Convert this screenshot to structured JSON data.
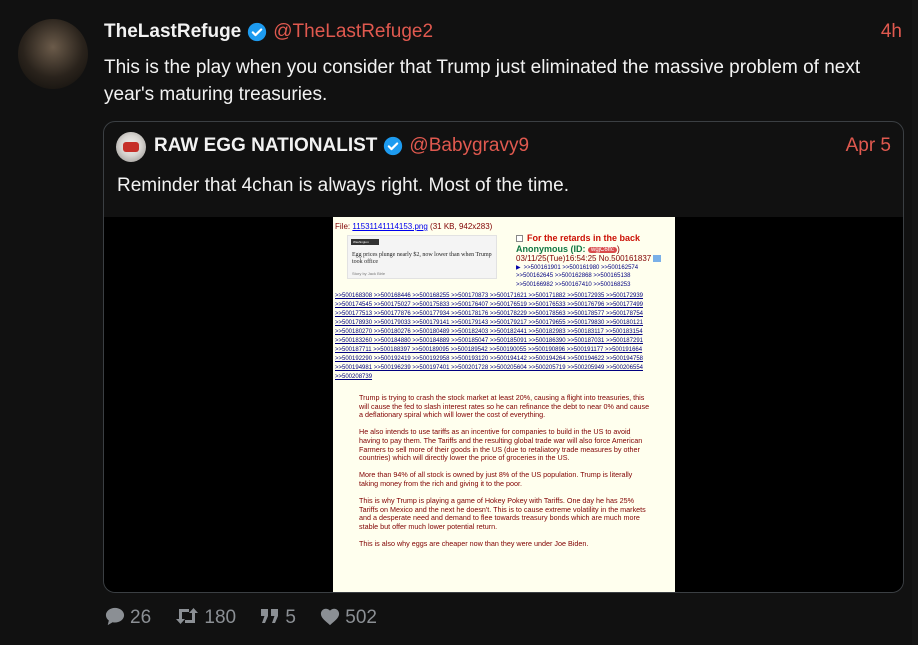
{
  "post": {
    "display_name": "TheLastRefuge",
    "handle": "@TheLastRefuge2",
    "time": "4h",
    "text": "This is the play when you consider that Trump just eliminated the massive problem of next year's maturing treasuries."
  },
  "quoted": {
    "display_name": "RAW EGG NATIONALIST",
    "handle": "@Babygravy9",
    "time": "Apr 5",
    "text": "Reminder that 4chan is always right. Most of the time."
  },
  "chan": {
    "file_prefix": "File: ",
    "file_name": "11531141114153.png",
    "file_meta": " (31 KB, 942x283)",
    "thumb_label": "Washington Examiner",
    "thumb_headline": "Egg prices plunge nearly $2, now lower than when Trump took office",
    "thumb_meta": "Story by Jack Birle",
    "subject": "For the retards in the back",
    "anon": "Anonymous (ID: ",
    "anon_id": "wgjC6ffc",
    "anon_close": ")",
    "datetime": "03/11/25(Tue)16:54:25 No.500161837",
    "replies_line1": ">>500161901 >>500161980 >>500162574",
    "replies_line2": ">>500162645 >>500162868 >>500165138",
    "replies_line3": ">>500166982 >>500167410 >>500168253",
    "replies": ">>500168308 >>500168446 >>500168255 >>500170873 >>500171621 >>500171882 >>500172935 >>500172939 >>500174545 >>500175027 >>500175833 >>500176407 >>500176519 >>500176533 >>500176796 >>500177499 >>500177513 >>500177876 >>500177934 >>500178176 >>500178229 >>500178563 >>500178577 >>500178754 >>500178930 >>500179033 >>500179141 >>500179143 >>500179217 >>500179655 >>500179830 >>500180121 >>500180270 >>500180276 >>500180489 >>500182403 >>500182441 >>500182983 >>500183117 >>500183154 >>500183260 >>500184880 >>500184889 >>500185047 >>500185091 >>500186390 >>500187031 >>500187291 >>500187711 >>500188397 >>500189095 >>500189542 >>500190055 >>500190896 >>500191177 >>500191664 >>500192290 >>500192419 >>500192958 >>500193120 >>500194142 >>500194264 >>500194622 >>500194758 >>500194981 >>500196239 >>500197401 >>500201728 >>500205604 >>500205719 >>500205949 >>500206554 >>500208739",
    "body": [
      "Trump is trying to crash the stock market at least 20%, causing a flight into treasuries, this will cause the fed to slash interest rates so he can refinance the debt to near 0% and cause a deflationary spiral which will lower the cost of everything.",
      "He also intends to use tariffs as an incentive for companies to build in the US to avoid having to pay them. The Tariffs and the resulting global trade war will also force American Farmers to sell more of their goods in the US (due to retaliatory trade measures by other countries) which will directly lower the price of groceries in the US.",
      "More than 94% of all stock is owned by just 8% of the US population. Trump is literally taking money from the rich and giving it to the poor.",
      "This is why Trump is playing a game of Hokey Pokey with Tariffs. One day he has 25% Tariffs on Mexico and the next he doesn't. This is to cause extreme volatility in the markets and a desperate need and demand to flee towards treasury bonds which are much more stable but offer much lower potential return.",
      "This is also why eggs are cheaper now than they were under Joe Biden."
    ]
  },
  "actions": {
    "replies": "26",
    "reposts": "180",
    "quotes": "5",
    "likes": "502"
  },
  "colors": {
    "background": "#111111",
    "accent_red": "#e0594f",
    "verified_blue": "#1d9bf0",
    "muted": "#8b8f94"
  }
}
